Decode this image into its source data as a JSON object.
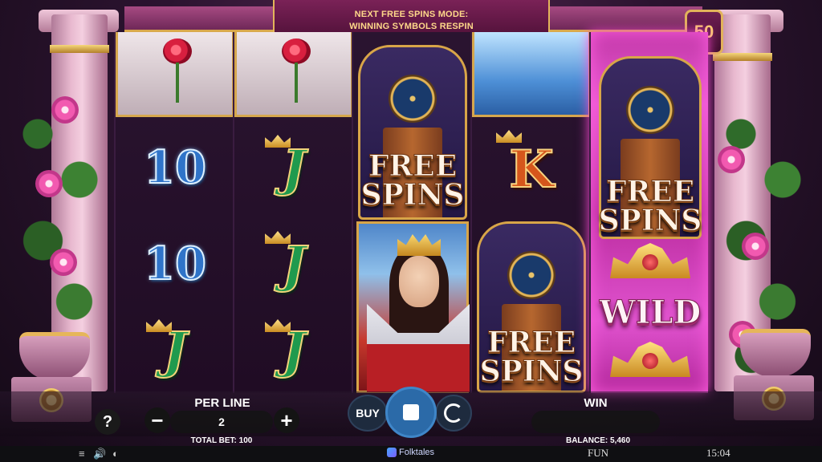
{
  "banner": {
    "line1": "NEXT FREE SPINS MODE:",
    "line2": "WINNING SYMBOLS RESPIN"
  },
  "lines_count": "50",
  "reels": [
    [
      "rose-cloche",
      "10",
      "10",
      "J"
    ],
    [
      "rose-cloche",
      "J",
      "J",
      "J"
    ],
    [
      "free-spins-clock",
      "queen"
    ],
    [
      "dress",
      "K",
      "free-spins-clock"
    ],
    [
      "free-spins-clock",
      "crown",
      "WILD",
      "crown"
    ]
  ],
  "symbols": {
    "ten": "10",
    "jack": "J",
    "king": "K",
    "wild": "WILD",
    "free_spins_top": "FREE",
    "free_spins_bottom": "SPINS"
  },
  "controls": {
    "help_label": "?",
    "minus_label": "−",
    "plus_label": "+",
    "per_line_title": "PER LINE",
    "per_line_value": "2",
    "total_bet": "TOTAL BET: 100",
    "buy_label": "BUY",
    "win_title": "WIN",
    "win_value": "",
    "balance": "BALANCE: 5,460"
  },
  "footer": {
    "menu_icon": "≡",
    "sound_icon": "🔊",
    "turbo_icon": "◐",
    "brand": "Folktales",
    "mode": "FUN",
    "time": "15:04"
  },
  "colors": {
    "accent_gold": "#e3b55a",
    "spin_button": "#2b6aa8",
    "wild_reel_glow": "#ff4bd8"
  }
}
